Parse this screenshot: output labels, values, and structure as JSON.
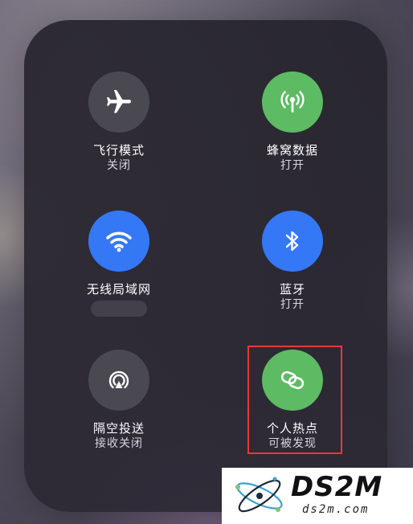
{
  "tiles": {
    "airplane": {
      "label": "飞行模式",
      "status": "关闭",
      "icon": "airplane-icon"
    },
    "cellular": {
      "label": "蜂窝数据",
      "status": "打开",
      "icon": "cellular-antenna-icon"
    },
    "wifi": {
      "label": "无线局域网",
      "status": "",
      "icon": "wifi-icon"
    },
    "bluetooth": {
      "label": "蓝牙",
      "status": "打开",
      "icon": "bluetooth-icon"
    },
    "airdrop": {
      "label": "隔空投送",
      "status": "接收关闭",
      "icon": "airdrop-icon"
    },
    "hotspot": {
      "label": "个人热点",
      "status": "可被发现",
      "icon": "hotspot-link-icon"
    }
  },
  "colors": {
    "inactive": "#4a4850",
    "green": "#5dbb63",
    "blue": "#3478f6",
    "highlight": "#e23b3b"
  },
  "watermark": {
    "title": "DS2M",
    "url": "ds2m.com"
  }
}
